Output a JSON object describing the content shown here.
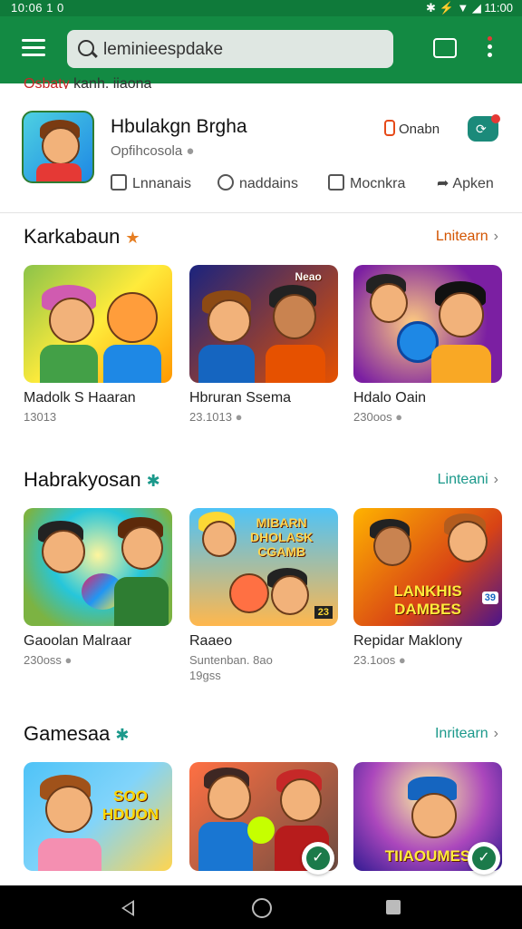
{
  "status_bar": {
    "time": "10:06 1 0",
    "right_icons": "✱ ⚡ ▼ ◢ 11:00"
  },
  "search": {
    "value": "leminieespdake"
  },
  "topbar": {
    "menu_icon": "menu-icon",
    "cast_icon": "cast-icon",
    "more_icon": "more-vert-icon"
  },
  "cutoff_title": {
    "left": "Osbaty",
    "right": "kanh. iiaona"
  },
  "app": {
    "title": "Hbulakgn Brgha",
    "subtitle": "Opfihcosola",
    "install_label": "Onabn",
    "actions": [
      "Lnnanais",
      "naddains",
      "Mocnkra",
      "Apken"
    ]
  },
  "sections": [
    {
      "title": "Karkabaun",
      "star_color": "#e67e22",
      "link": "Lnitearn",
      "link_color": "#d35400",
      "tiles": [
        {
          "name": "Madolk S Haaran",
          "meta": "13013",
          "meta2": ""
        },
        {
          "name": "Hbruran Ssema",
          "meta": "23.1013",
          "meta2": ""
        },
        {
          "name": "Hdalo Oain",
          "meta": "230oos",
          "meta2": ""
        }
      ]
    },
    {
      "title": "Habrakyosan",
      "star_color": "#1b998b",
      "link": "Linteani",
      "link_color": "#1b998b",
      "tiles": [
        {
          "name": "Gaoolan Malraar",
          "meta": "230oss",
          "meta2": ""
        },
        {
          "name": "Raaeo",
          "meta": "Suntenban. 8ao",
          "meta2": "19gss"
        },
        {
          "name": "Repidar Maklony",
          "meta": "23.1oos",
          "meta2": ""
        }
      ]
    },
    {
      "title": "Gamesaa",
      "star_color": "#1b998b",
      "link": "Inritearn",
      "link_color": "#1b998b",
      "tiles": [
        {
          "name": "",
          "meta": "",
          "meta2": ""
        },
        {
          "name": "",
          "meta": "",
          "meta2": ""
        },
        {
          "name": "",
          "meta": "",
          "meta2": ""
        }
      ]
    }
  ],
  "thumb_labels": {
    "s1t2": "Neao",
    "s2t2": "MIBARN DHOLASK CGAMB",
    "s2t2_num": "23",
    "s2t3": "LANKHIS DAMBES",
    "s2t3_num": "39",
    "s3t1": "SOO HDUON",
    "s3t3": "TIIAOUMES"
  }
}
